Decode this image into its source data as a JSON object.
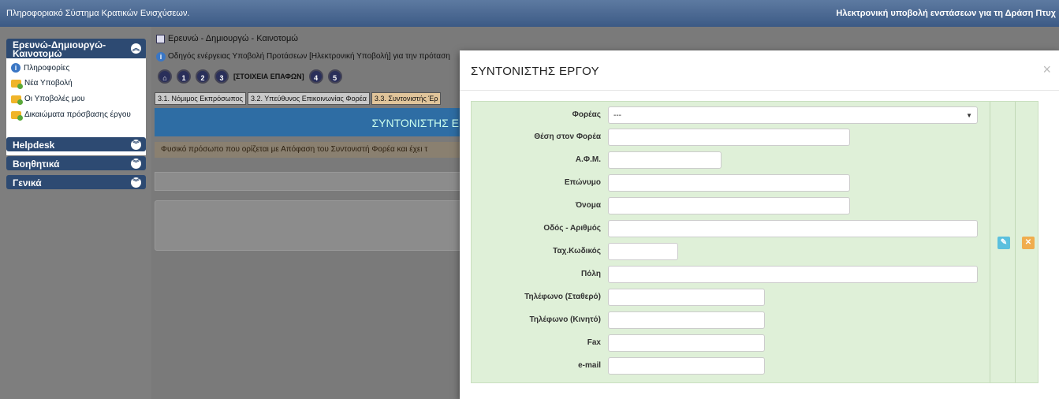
{
  "topbar": {
    "system_title": "Πληροφοριακό Σύστημα Κρατικών Ενισχύσεων.",
    "subtitle": "Ηλεκτρονική υποβολή ενστάσεων για τη Δράση Πτυχ"
  },
  "sidebar": {
    "section_main": "Ερευνώ-Δημιουργώ-Καινοτομώ",
    "items": [
      {
        "label": "Πληροφορίες",
        "icon": "info-icon"
      },
      {
        "label": "Νέα Υποβολή",
        "icon": "folder-add-icon"
      },
      {
        "label": "Οι Υποβολές μου",
        "icon": "folder-add-icon"
      },
      {
        "label": "Δικαιώματα πρόσβασης έργου",
        "icon": "folder-add-icon"
      }
    ],
    "sections": [
      "Helpdesk",
      "Βοηθητικά",
      "Γενικά"
    ]
  },
  "main": {
    "breadcrumb": "Ερευνώ - Δημιουργώ - Καινοτομώ",
    "guide": "Οδηγός ενέργειας Υποβολή Προτάσεων [Ηλεκτρονική Υποβολή] για την πρόταση",
    "steps": [
      "1",
      "2",
      "3",
      "4",
      "5"
    ],
    "active_step_label": "[ΣΤΟΙΧΕΙΑ ΕΠΑΦΩΝ]",
    "tabs": [
      "3.1. Νόμιμος Εκπρόσωπος",
      "3.2. Υπεύθυνος Επικοινωνίας Φορέα",
      "3.3. Συντονιστής Έρ"
    ],
    "band_title": "ΣΥΝΤΟΝΙΣΤΗΣ Ε",
    "note": "Φυσικό πρόσωπο που ορίζεται με Απόφαση του Συντονιστή Φορέα και έχει τ"
  },
  "modal": {
    "title": "ΣΥΝΤΟΝΙΣΤΗΣ ΕΡΓΟΥ",
    "close": "×",
    "fields": [
      {
        "label": "Φορέας",
        "value": "---",
        "type": "select"
      },
      {
        "label": "Θέση στον Φορέα",
        "value": ""
      },
      {
        "label": "Α.Φ.Μ.",
        "value": ""
      },
      {
        "label": "Επώνυμο",
        "value": ""
      },
      {
        "label": "Όνομα",
        "value": ""
      },
      {
        "label": "Οδός - Αριθμός",
        "value": ""
      },
      {
        "label": "Ταχ.Κωδικός",
        "value": ""
      },
      {
        "label": "Πόλη",
        "value": ""
      },
      {
        "label": "Τηλέφωνο (Σταθερό)",
        "value": ""
      },
      {
        "label": "Τηλέφωνο (Κινητό)",
        "value": ""
      },
      {
        "label": "Fax",
        "value": ""
      },
      {
        "label": "e-mail",
        "value": ""
      }
    ],
    "actions": {
      "edit": "edit-icon",
      "delete": "delete-icon"
    }
  },
  "colors": {
    "topbar": "#3c5a85",
    "panel_bg": "#dff0d8",
    "edit_btn": "#5bc0de",
    "delete_btn": "#f0ad4e"
  }
}
